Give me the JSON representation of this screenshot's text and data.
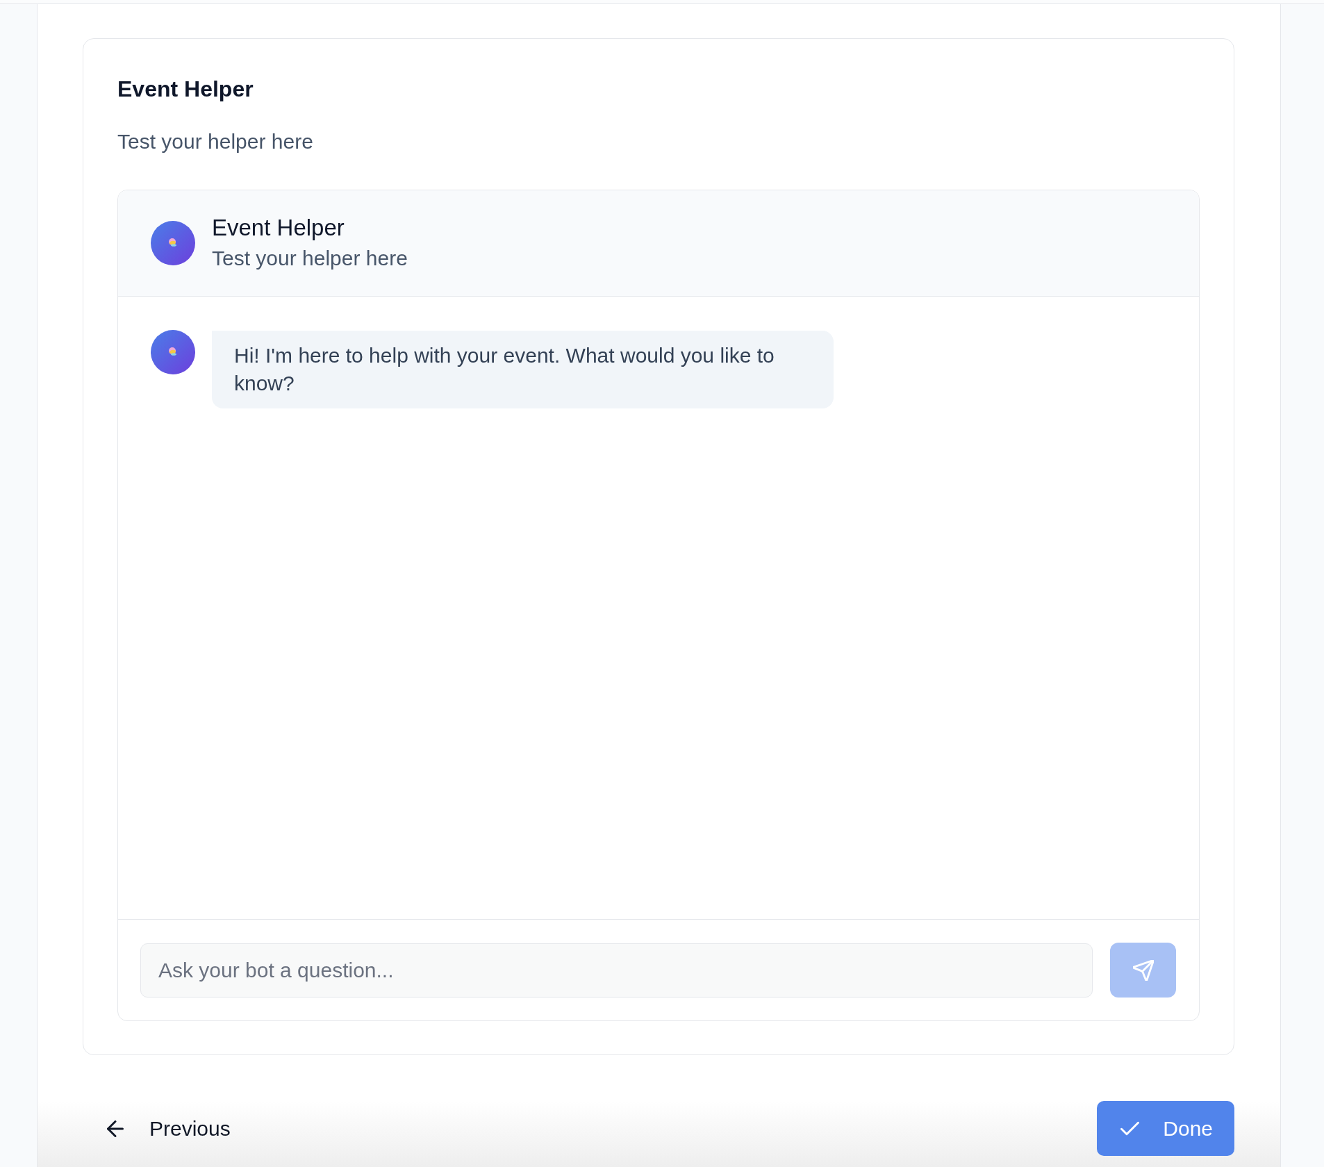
{
  "page": {
    "title": "Event Helper",
    "subtitle": "Test your helper here"
  },
  "chat": {
    "header": {
      "title": "Event Helper",
      "subtitle": "Test your helper here"
    },
    "messages": [
      {
        "kind": "bot",
        "text": "Hi! I'm here to help with your event. What would you like to know?"
      }
    ],
    "input": {
      "placeholder": "Ask your bot a question..."
    },
    "send_button": {
      "disabled": true
    }
  },
  "footer": {
    "previous_button": {
      "label": "Previous"
    },
    "done_button": {
      "label": "Done"
    }
  }
}
